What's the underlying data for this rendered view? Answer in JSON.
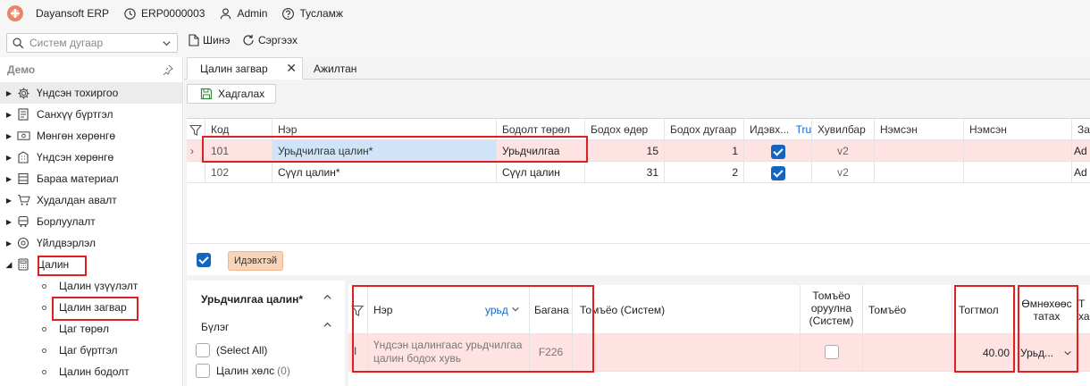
{
  "topbar": {
    "app_name": "Dayansoft ERP",
    "company": "ERP0000003",
    "user": "Admin",
    "help": "Тусламж"
  },
  "toolbar": {
    "search_placeholder": "Систем дугаар",
    "new_label": "Шинэ",
    "refresh_label": "Сэргээх"
  },
  "sidebar": {
    "title": "Демо",
    "items": [
      {
        "label": "Үндсэн тохиргоо",
        "icon": "gear-icon"
      },
      {
        "label": "Санхүү бүртгэл",
        "icon": "ledger-icon"
      },
      {
        "label": "Мөнгөн хөрөнгө",
        "icon": "money-icon"
      },
      {
        "label": "Үндсэн хөрөнгө",
        "icon": "building-icon"
      },
      {
        "label": "Бараа материал",
        "icon": "box-icon"
      },
      {
        "label": "Худалдан авалт",
        "icon": "cart-icon"
      },
      {
        "label": "Борлуулалт",
        "icon": "truck-icon"
      },
      {
        "label": "Үйлдвэрлэл",
        "icon": "factory-icon"
      },
      {
        "label": "Цалин",
        "icon": "calculator-icon"
      }
    ],
    "subitems": [
      "Цалин үзүүлэлт",
      "Цалин загвар",
      "Цаг төрөл",
      "Цаг бүртгэл",
      "Цалин бодолт"
    ]
  },
  "tabs": [
    "Цалин загвар",
    "Ажилтан"
  ],
  "save_label": "Хадгалах",
  "grid1": {
    "columns": [
      "Код",
      "Нэр",
      "Бодолт төрөл",
      "Бодох өдөр",
      "Бодох дугаар",
      "Идэвх...",
      "Хувилбар",
      "Нэмсэн",
      "Нэмсэн",
      "Зас"
    ],
    "filter_value": "True",
    "rows": [
      {
        "code": "101",
        "name": "Урьдчилгаа цалин*",
        "type": "Урьдчилгаа",
        "day": "15",
        "num": "1",
        "active": true,
        "version": "v2",
        "extra": "Ad"
      },
      {
        "code": "102",
        "name": "Сүүл цалин*",
        "type": "Сүүл цалин",
        "day": "31",
        "num": "2",
        "active": true,
        "version": "v2",
        "extra": "Ad"
      }
    ],
    "filter_badge": "Идэвхтэй"
  },
  "detail": {
    "title": "Урьдчилгаа цалин*",
    "group_label": "Бүлэг",
    "options": [
      {
        "label": "(Select All)",
        "count": ""
      },
      {
        "label": "Цалин хөлс",
        "count": "(0)"
      }
    ]
  },
  "grid2": {
    "columns": {
      "name": "Нэр",
      "name_filter": "урьд",
      "column": "Багана",
      "formula_sys": "Томъёо (Систем)",
      "formula_edit_1": "Томъёо",
      "formula_edit_2": "оруулна",
      "formula_edit_3": "(Систем)",
      "formula": "Томъёо",
      "fixed": "Тогтмол",
      "prev_1": "Өмнөхөөс",
      "prev_2": "татах",
      "more_1": "Т",
      "more_2": "ха"
    },
    "row": {
      "name_line1": "Үндсэн цалингаас урьдчилгаа",
      "name_line2": "цалин бодох хувь",
      "column": "F226",
      "fixed": "40.00",
      "prev": "Урьд..."
    }
  },
  "colors": {
    "accent": "#1565c0",
    "highlight": "#ffe3e3",
    "annotation": "#e02020"
  }
}
